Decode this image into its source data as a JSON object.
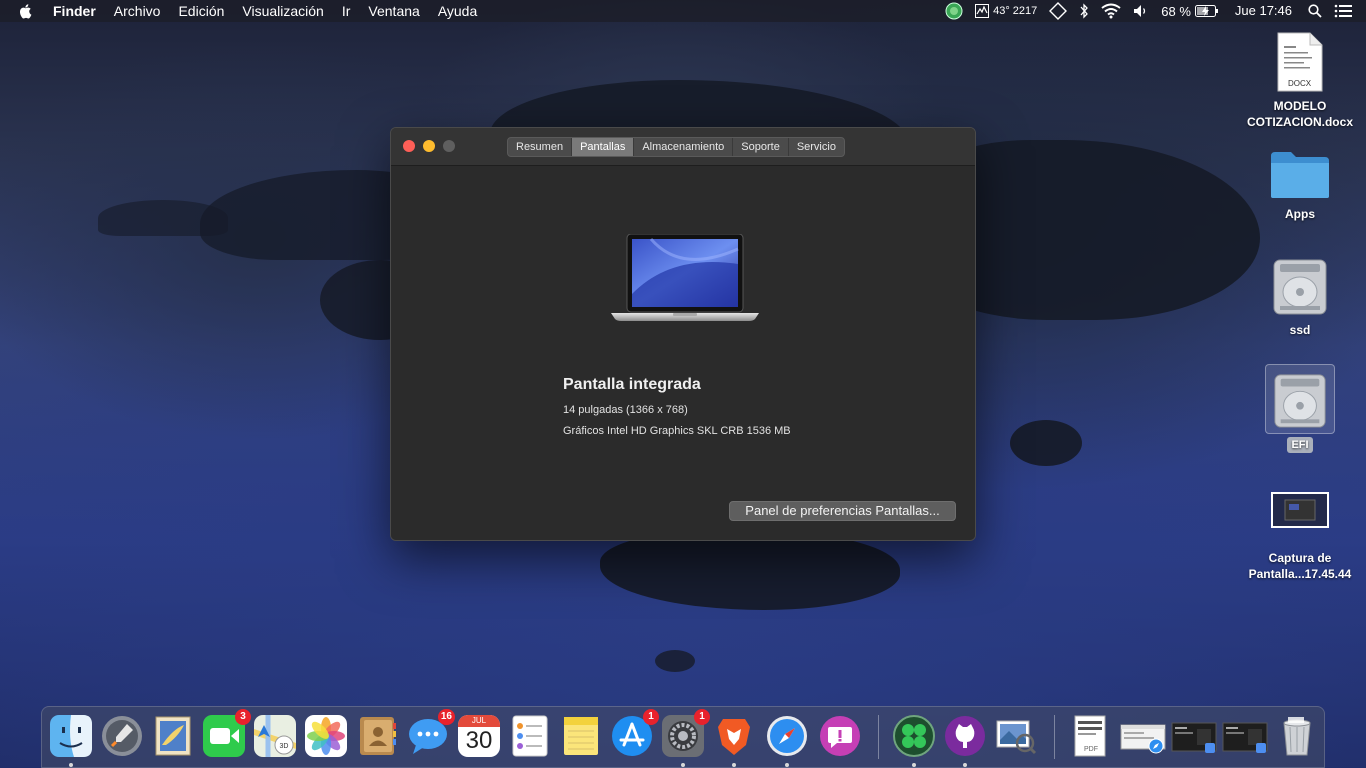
{
  "menubar": {
    "app_name": "Finder",
    "menus": [
      "Archivo",
      "Edición",
      "Visualización",
      "Ir",
      "Ventana",
      "Ayuda"
    ],
    "status": {
      "cpu_text": "43° 2217",
      "battery_percent": "68 %",
      "clock": "Jue 17:46"
    }
  },
  "desktop_icons": [
    {
      "label": "MODELO COTIZACION.docx",
      "badge": "DOCX"
    },
    {
      "label": "Apps"
    },
    {
      "label": "ssd"
    },
    {
      "label": "EFI"
    },
    {
      "label": "Captura de Pantalla...17.45.44"
    }
  ],
  "window": {
    "tabs": [
      "Resumen",
      "Pantallas",
      "Almacenamiento",
      "Soporte",
      "Servicio"
    ],
    "active_tab": "Pantallas",
    "display_title": "Pantalla integrada",
    "display_size": "14 pulgadas (1366 x 768)",
    "graphics": "Gráficos Intel HD Graphics SKL CRB 1536 MB",
    "prefs_button": "Panel de preferencias Pantallas..."
  },
  "dock": {
    "items": [
      {
        "name": "Finder",
        "icon": "finder-icon",
        "running": true
      },
      {
        "name": "Launchpad",
        "icon": "launchpad-icon"
      },
      {
        "name": "Mail",
        "icon": "mail-icon"
      },
      {
        "name": "FaceTime",
        "icon": "facetime-icon",
        "badge": "3"
      },
      {
        "name": "Mapas",
        "icon": "maps-icon"
      },
      {
        "name": "Fotos",
        "icon": "photos-icon"
      },
      {
        "name": "Contactos",
        "icon": "contacts-icon"
      },
      {
        "name": "Mensajes",
        "icon": "messages-icon",
        "badge": "16"
      },
      {
        "name": "Calendario",
        "icon": "calendar-icon",
        "month": "JUL",
        "day": "30"
      },
      {
        "name": "Recordatorios",
        "icon": "reminders-icon"
      },
      {
        "name": "Notas",
        "icon": "notes-icon"
      },
      {
        "name": "App Store",
        "icon": "app-store-icon",
        "badge": "1"
      },
      {
        "name": "Preferencias del Sistema",
        "icon": "system-preferences-icon",
        "badge": "1",
        "running": true
      },
      {
        "name": "Brave",
        "icon": "brave-icon",
        "running": true
      },
      {
        "name": "Safari",
        "icon": "safari-icon",
        "running": true
      },
      {
        "name": "Feedback",
        "icon": "feedback-icon"
      },
      {
        "name": "Clover",
        "icon": "clover-icon",
        "running": true
      },
      {
        "name": "GitHub Desktop",
        "icon": "github-icon",
        "running": true
      },
      {
        "name": "Vista Previa",
        "icon": "preview-icon"
      },
      {
        "name": "Documento PDF",
        "icon": "pdf-document-icon",
        "label": "PDF"
      },
      {
        "name": "Ventana Safari",
        "icon": "safari-window-icon"
      },
      {
        "name": "Ventana minimizada",
        "icon": "minimized-window-icon"
      },
      {
        "name": "Ventana minimizada 2",
        "icon": "minimized-window-icon"
      },
      {
        "name": "Papelera",
        "icon": "trash-icon"
      }
    ]
  },
  "colors": {
    "close": "#fe5f57",
    "minimize": "#febc2e",
    "zoom_inactive": "#5f5f5f",
    "folder": "#4fa7e3",
    "badge": "#e8222c"
  }
}
